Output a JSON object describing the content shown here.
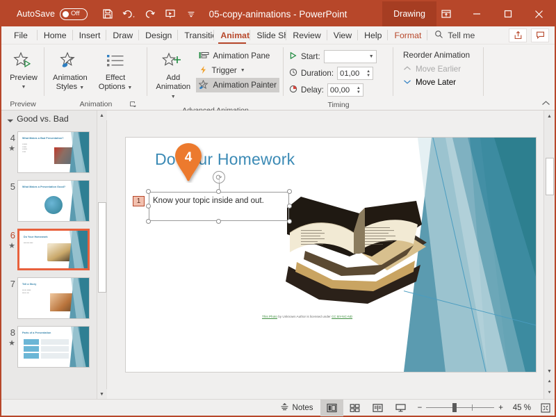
{
  "titlebar": {
    "autosave_label": "AutoSave",
    "autosave_state": "Off",
    "save_icon": "save-icon",
    "undo_icon": "undo-icon",
    "redo_icon": "redo-icon",
    "present_icon": "start-presentation-icon",
    "customize_icon": "customize-quick-access-icon",
    "document_title": "05-copy-animations  -  PowerPoint",
    "contextual_tab": "Drawing",
    "ribbon_display_icon": "ribbon-display-options-icon",
    "minimize_icon": "minimize-icon",
    "maximize_icon": "maximize-icon",
    "close_icon": "close-icon",
    "accent_color": "#b7472a"
  },
  "tabs": [
    {
      "label": "File",
      "active": false
    },
    {
      "label": "Home",
      "active": false
    },
    {
      "label": "Insert",
      "active": false
    },
    {
      "label": "Draw",
      "active": false
    },
    {
      "label": "Design",
      "active": false
    },
    {
      "label": "Transitio",
      "active": false
    },
    {
      "label": "Animatic",
      "active": true
    },
    {
      "label": "Slide Sho",
      "active": false
    },
    {
      "label": "Review",
      "active": false
    },
    {
      "label": "View",
      "active": false
    },
    {
      "label": "Help",
      "active": false
    },
    {
      "label": "Format",
      "active": false
    }
  ],
  "tellme": {
    "label": "Tell me",
    "icon": "search-icon"
  },
  "tab_right": {
    "share_icon": "share-icon",
    "comments_icon": "comments-icon"
  },
  "ribbon": {
    "groups": [
      {
        "title": "Preview",
        "buttons": [
          {
            "label_line1": "Preview",
            "label_line2": "",
            "icon": "preview-star-play-icon",
            "dropdown": true
          }
        ]
      },
      {
        "title": "Animation",
        "buttons": [
          {
            "label_line1": "Animation",
            "label_line2": "Styles",
            "icon": "animation-styles-icon",
            "dropdown": true
          },
          {
            "label_line1": "Effect",
            "label_line2": "Options",
            "icon": "effect-options-icon",
            "dropdown": true
          }
        ],
        "dialog_launcher": true
      },
      {
        "title": "Advanced Animation",
        "buttons": [
          {
            "label_line1": "Add",
            "label_line2": "Animation",
            "icon": "add-animation-icon",
            "dropdown": true
          }
        ],
        "items": [
          {
            "label": "Animation Pane",
            "icon": "animation-pane-icon",
            "highlighted": false
          },
          {
            "label": "Trigger",
            "icon": "trigger-lightning-icon",
            "dropdown": true,
            "highlighted": false
          },
          {
            "label": "Animation Painter",
            "icon": "animation-painter-icon",
            "highlighted": true
          }
        ]
      },
      {
        "title": "Timing",
        "fields": [
          {
            "label": "Start:",
            "value": "",
            "icon": "play-triangle-icon",
            "type": "dropdown"
          },
          {
            "label": "Duration:",
            "value": "01,00",
            "icon": "clock-icon",
            "type": "spinner"
          },
          {
            "label": "Delay:",
            "value": "00,00",
            "icon": "delay-clock-icon",
            "type": "spinner"
          }
        ]
      },
      {
        "title": "",
        "reorder_title": "Reorder Animation",
        "reorder_items": [
          {
            "label": "Move Earlier",
            "icon": "chevron-up-icon",
            "disabled": true
          },
          {
            "label": "Move Later",
            "icon": "chevron-down-icon",
            "disabled": false
          }
        ]
      }
    ],
    "collapse_icon": "collapse-ribbon-icon"
  },
  "thumbnails": {
    "section_label": "Good vs. Bad",
    "section_collapse_icon": "triangle-collapse-icon",
    "slides": [
      {
        "number": "4",
        "has_animation": true,
        "title": "What Makes a Bad Presentation?",
        "selected": false
      },
      {
        "number": "5",
        "has_animation": false,
        "title": "What Makes a Presentation Good?",
        "selected": false
      },
      {
        "number": "6",
        "has_animation": true,
        "title": "Do Your Homework",
        "selected": true
      },
      {
        "number": "7",
        "has_animation": false,
        "title": "Tell a Story",
        "selected": false
      },
      {
        "number": "8",
        "has_animation": true,
        "title": "Parts of a Presentation",
        "selected": false
      }
    ],
    "scroll_up_icon": "scroll-up-icon",
    "scroll_down_icon": "scroll-down-icon"
  },
  "slide": {
    "title": "Do Your Homework",
    "body_text": "Know your topic inside and out.",
    "animation_marker": "1",
    "pin_number": "4",
    "credit_prefix": "This Photo",
    "credit_middle": " by Unknown Author is licensed under ",
    "credit_license": "CC BY-NC-ND",
    "title_color": "#3b8ab5",
    "pin_color": "#ec7a2d",
    "image_alt": "stack-of-open-books-photo"
  },
  "canvas_scroll": {
    "up_icon": "scroll-up-icon",
    "down_icon": "scroll-down-icon",
    "prev_slide_icon": "previous-slide-icon",
    "next_slide_icon": "next-slide-icon"
  },
  "statusbar": {
    "notes_label": "Notes",
    "notes_icon": "notes-icon",
    "views": [
      {
        "name": "normal-view",
        "icon": "normal-view-icon",
        "active": true
      },
      {
        "name": "slide-sorter-view",
        "icon": "slide-sorter-icon",
        "active": false
      },
      {
        "name": "reading-view",
        "icon": "reading-view-icon",
        "active": false
      },
      {
        "name": "slide-show-view",
        "icon": "slide-show-icon",
        "active": false
      }
    ],
    "zoom_out_label": "−",
    "zoom_in_label": "+",
    "zoom_percent": "45 %",
    "fit_icon": "fit-slide-to-window-icon"
  }
}
